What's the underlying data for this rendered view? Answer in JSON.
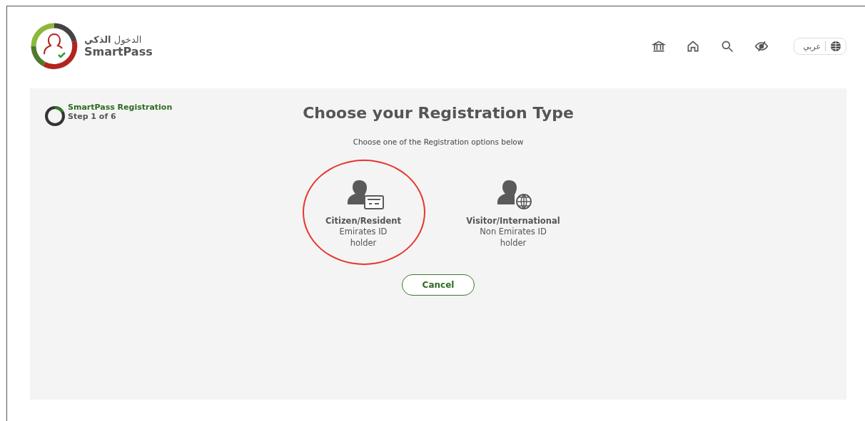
{
  "header": {
    "logo_arabic": "الدخول **الذكي**",
    "logo_name": "SmartPass",
    "nav_icons": [
      {
        "kind": "government"
      },
      {
        "kind": "home"
      },
      {
        "kind": "search"
      },
      {
        "kind": "accessibility"
      }
    ],
    "language_button": "عربي"
  },
  "progress": {
    "title": "SmartPass Registration",
    "step": "Step 1 of 6",
    "level": 0.17
  },
  "main": {
    "title": "Choose your Registration Type",
    "subtitle": "Choose one of the Registration options below",
    "options": [
      {
        "kind": "id-card",
        "title": "Citizen/Resident",
        "lines": [
          "Emirates ID",
          "holder"
        ],
        "highlighted": true
      },
      {
        "kind": "globe",
        "title": "Visitor/International",
        "lines": [
          "Non Emirates ID",
          "holder"
        ],
        "highlighted": false
      }
    ],
    "cancel": "Cancel"
  }
}
